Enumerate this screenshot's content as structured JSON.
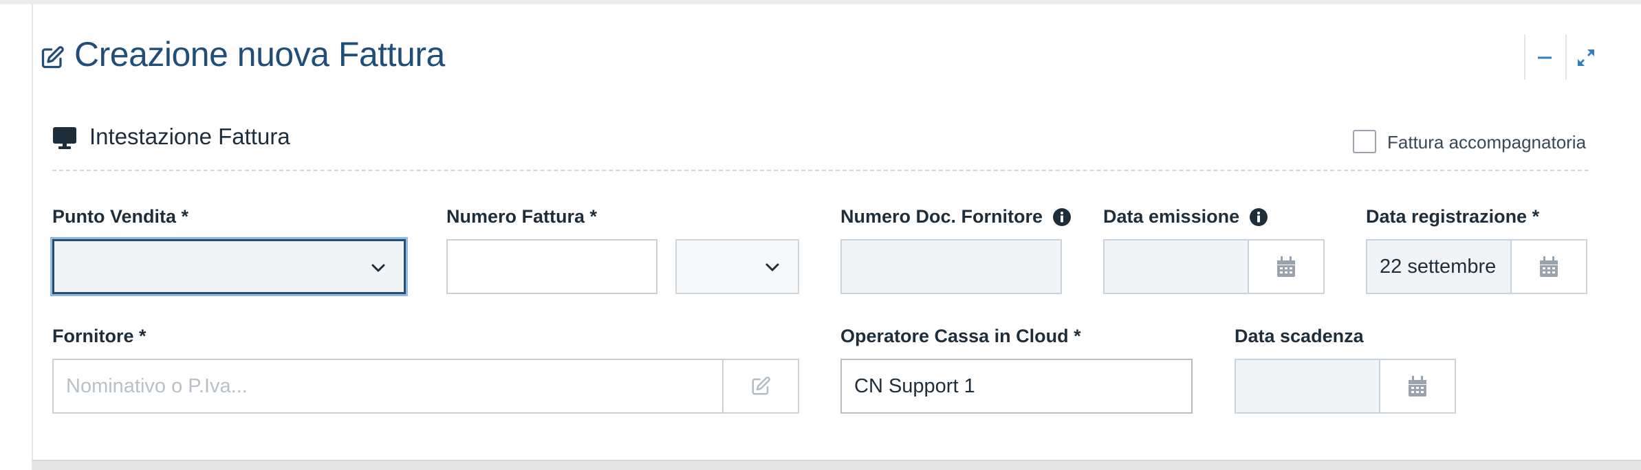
{
  "header": {
    "title": "Creazione nuova Fattura",
    "title_icon": "edit-icon",
    "minimize_icon": "minus-icon",
    "expand_icon": "expand-icon"
  },
  "section": {
    "title": "Intestazione Fattura",
    "icon": "monitor-icon"
  },
  "checkbox": {
    "label": "Fattura accompagnatoria",
    "checked": false
  },
  "fields": {
    "punto_vendita": {
      "label": "Punto Vendita *",
      "value": ""
    },
    "numero_fattura": {
      "label": "Numero Fattura *",
      "value": "",
      "suffix_value": ""
    },
    "numero_doc_fornitore": {
      "label": "Numero Doc. Fornitore",
      "value": ""
    },
    "data_emissione": {
      "label": "Data emissione",
      "value": ""
    },
    "data_registrazione": {
      "label": "Data registrazione *",
      "value": "22 settembre"
    },
    "fornitore": {
      "label": "Fornitore *",
      "placeholder": "Nominativo o P.Iva...",
      "value": ""
    },
    "operatore": {
      "label": "Operatore Cassa in Cloud *",
      "value": "CN Support 1"
    },
    "data_scadenza": {
      "label": "Data scadenza",
      "value": ""
    }
  },
  "colors": {
    "title": "#1f4e79",
    "accent": "#2f7fc6",
    "focus_border": "#1f4e79"
  }
}
